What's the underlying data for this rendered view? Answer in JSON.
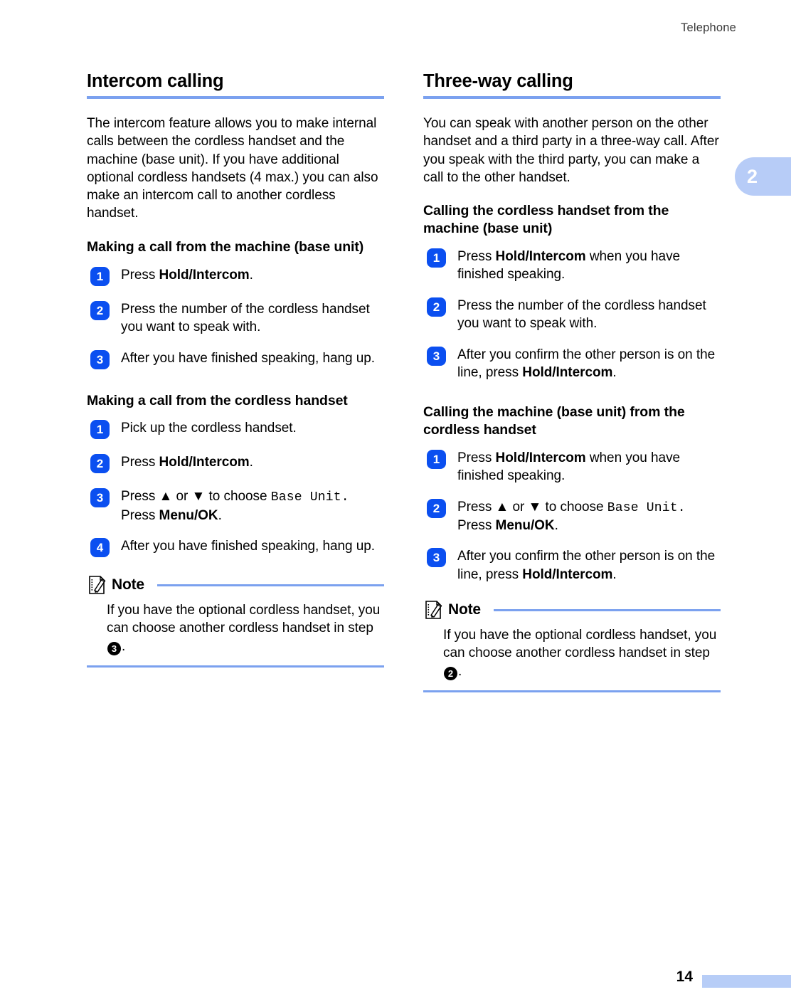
{
  "header": {
    "running_title": "Telephone"
  },
  "chapter_tab": {
    "number": "2"
  },
  "footer": {
    "page_number": "14"
  },
  "left_column": {
    "section_title": "Intercom calling",
    "intro_paragraph": "The intercom feature allows you to make internal calls between the cordless handset and the machine (base unit). If you have additional optional cordless handsets (4 max.) you can also make an intercom call to another cordless handset.",
    "subsection_1": {
      "title": "Making a call from the machine (base unit)",
      "steps": [
        {
          "num": "1",
          "pre": "Press ",
          "kbd": "Hold/Intercom",
          "post": "."
        },
        {
          "num": "2",
          "pre": "Press the number of the cordless handset you want to speak with.",
          "kbd": "",
          "post": ""
        },
        {
          "num": "3",
          "pre": "After you have finished speaking, hang up.",
          "kbd": "",
          "post": ""
        }
      ]
    },
    "subsection_2": {
      "title": "Making a call from the cordless handset",
      "steps": [
        {
          "num": "1",
          "pre": "Pick up the cordless handset.",
          "kbd": "",
          "post": ""
        },
        {
          "num": "2",
          "pre": "Press ",
          "kbd": "Hold/Intercom",
          "post": "."
        },
        {
          "num": "3",
          "pre": "Press ▲ or ▼ to choose ",
          "mono": "Base Unit.",
          "mid": " Press ",
          "kbd": "Menu/OK",
          "post": "."
        },
        {
          "num": "4",
          "pre": "After you have finished speaking, hang up.",
          "kbd": "",
          "post": ""
        }
      ]
    },
    "note": {
      "label": "Note",
      "text_before": "If you have the optional cordless handset, you can choose another cordless handset in step ",
      "step_ref": "3",
      "text_after": "."
    }
  },
  "right_column": {
    "section_title": "Three-way calling",
    "intro_paragraph": "You can speak with another person on the other handset and a third party in a three-way call. After you speak with the third party, you can make a call to the other handset.",
    "subsection_1": {
      "title": "Calling the cordless handset from the machine (base unit)",
      "steps": [
        {
          "num": "1",
          "pre": "Press ",
          "kbd": "Hold/Intercom",
          "post": " when you have finished speaking."
        },
        {
          "num": "2",
          "pre": "Press the number of the cordless handset you want to speak with.",
          "kbd": "",
          "post": ""
        },
        {
          "num": "3",
          "pre": "After you confirm the other person is on the line, press ",
          "kbd": "Hold/Intercom",
          "post": "."
        }
      ]
    },
    "subsection_2": {
      "title": "Calling the machine (base unit) from the cordless handset",
      "steps": [
        {
          "num": "1",
          "pre": "Press ",
          "kbd": "Hold/Intercom",
          "post": " when you have finished speaking."
        },
        {
          "num": "2",
          "pre": "Press ▲ or ▼ to choose ",
          "mono": "Base Unit.",
          "mid": " Press ",
          "kbd": "Menu/OK",
          "post": "."
        },
        {
          "num": "3",
          "pre": "After you confirm the other person is on the line, press ",
          "kbd": "Hold/Intercom",
          "post": "."
        }
      ]
    },
    "note": {
      "label": "Note",
      "text_before": "If you have the optional cordless handset, you can choose another cordless handset in step ",
      "step_ref": "2",
      "text_after": "."
    }
  },
  "colors": {
    "rule_blue": "#7ba1ef",
    "tab_blue": "#b7ccf7",
    "badge_blue": "#0b4ff0"
  }
}
